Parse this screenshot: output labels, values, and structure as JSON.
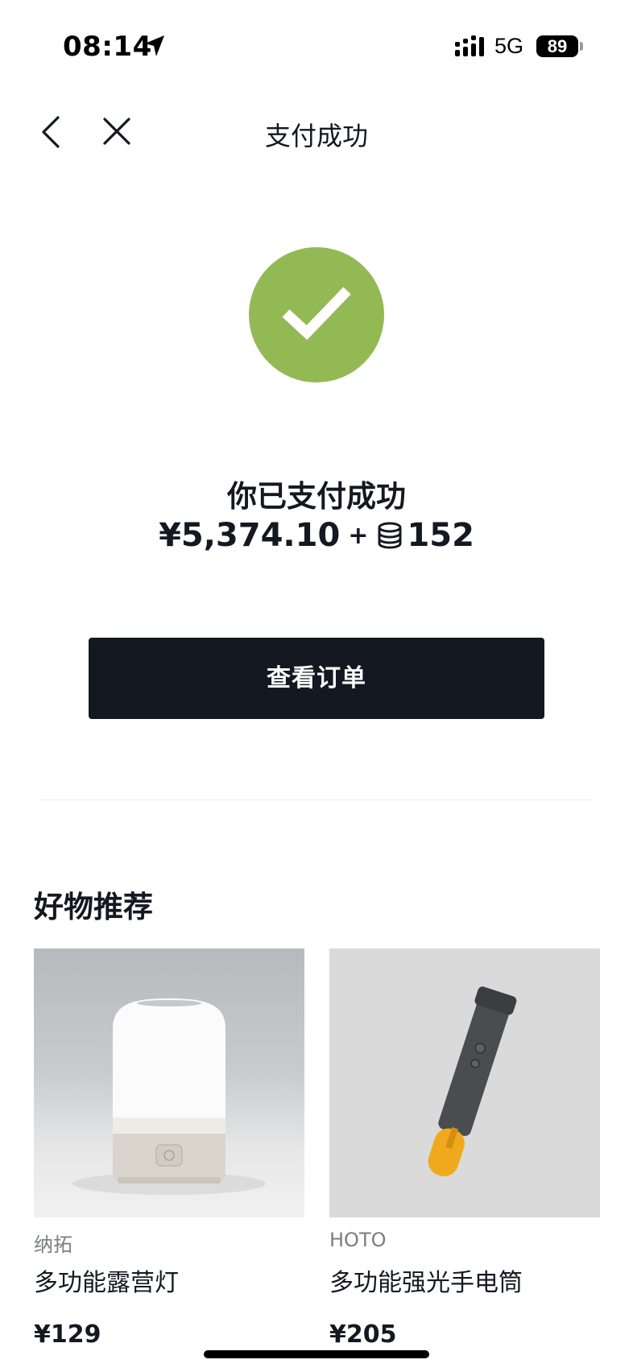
{
  "status_bar": {
    "time": "08:14",
    "network": "5G",
    "battery": "89"
  },
  "nav": {
    "title": "支付成功"
  },
  "success": {
    "message": "你已支付成功",
    "currency_symbol": "¥",
    "amount": "5,374.10",
    "plus": "+",
    "coins": "152",
    "accent_color": "#93b955"
  },
  "actions": {
    "view_order_label": "查看订单"
  },
  "recommend": {
    "title": "好物推荐",
    "products": [
      {
        "brand": "纳拓",
        "name": "多功能露营灯",
        "price": "¥129"
      },
      {
        "brand": "HOTO",
        "name": "多功能强光手电筒",
        "price": "¥205"
      }
    ]
  }
}
